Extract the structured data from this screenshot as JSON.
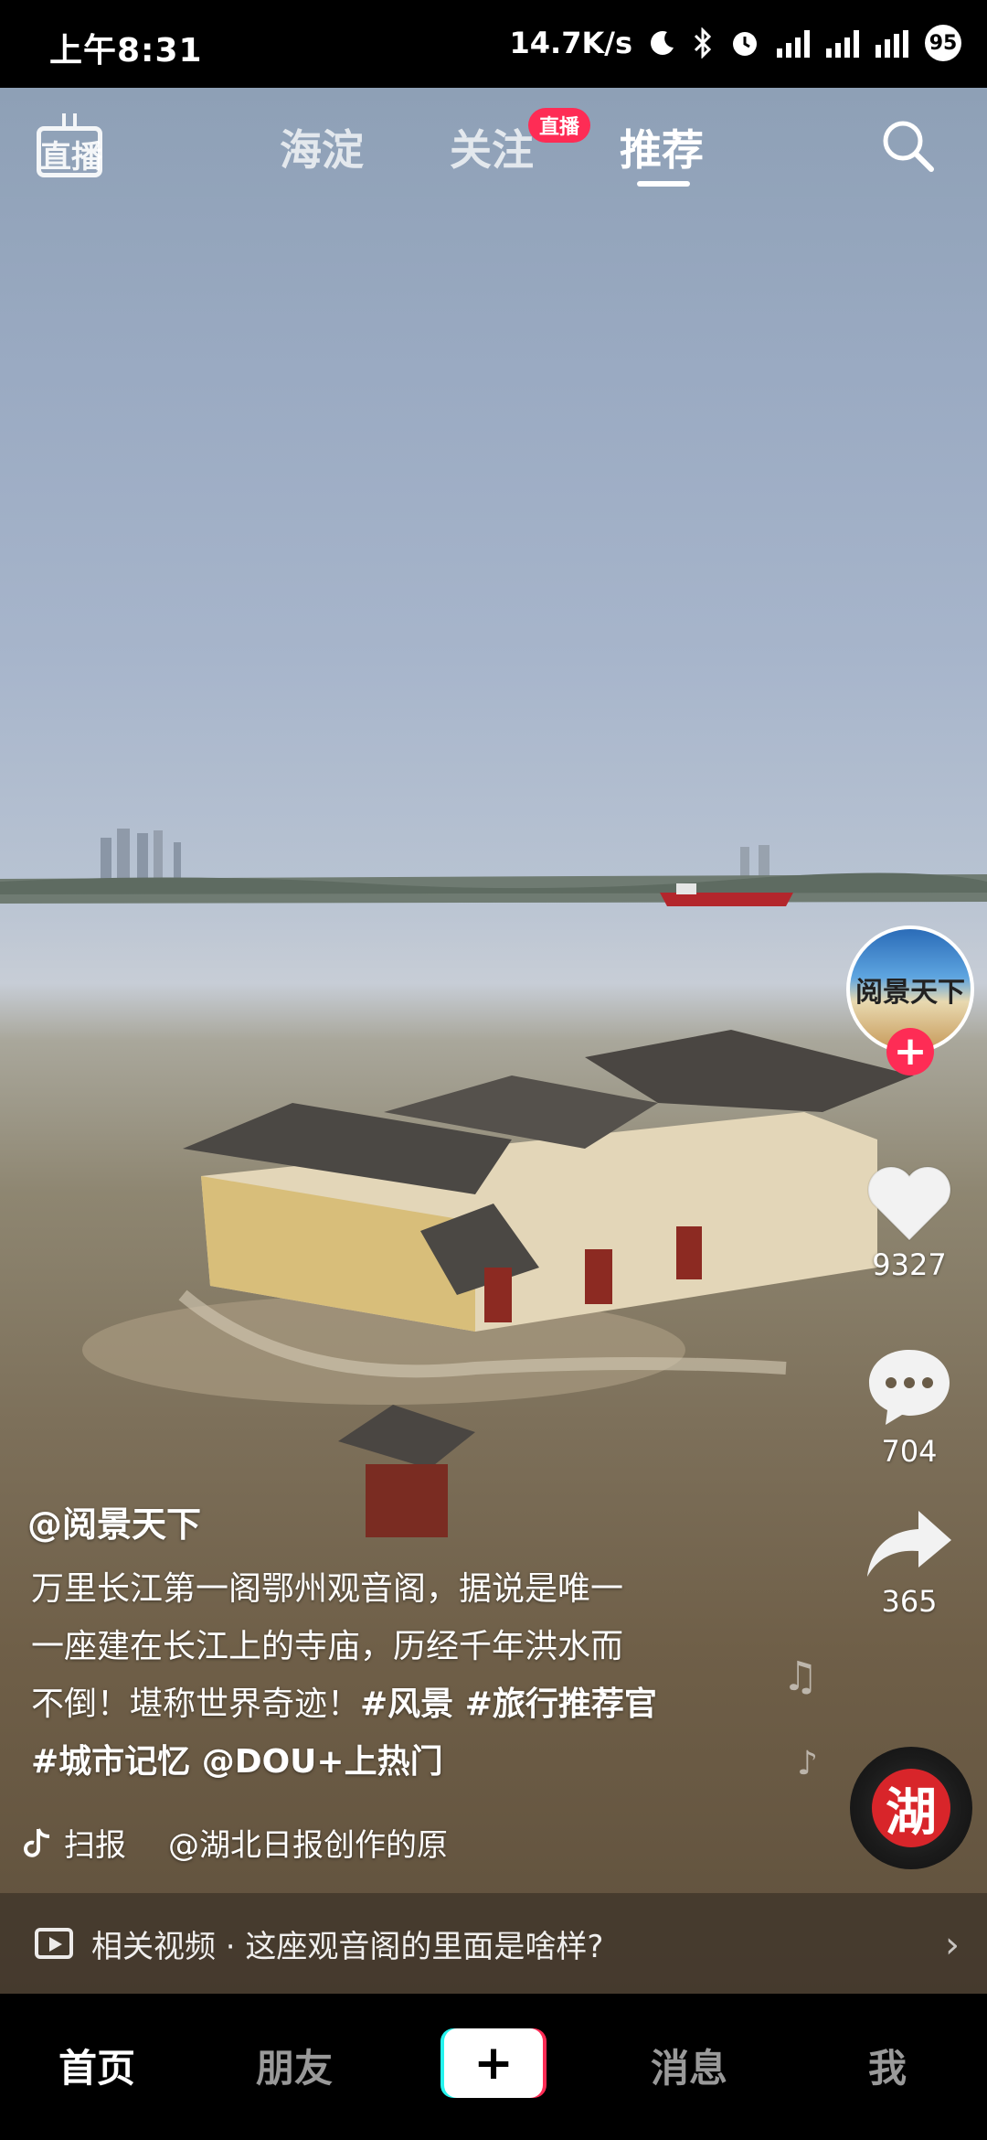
{
  "status_bar": {
    "time": "上午8:31",
    "network_speed": "14.7K/s",
    "battery": "95",
    "icons": [
      "moon-icon",
      "bluetooth-icon",
      "alarm-icon",
      "signal-hd-icon",
      "signal-hd-icon",
      "wifi-icon"
    ]
  },
  "top_nav": {
    "live_label": "直播",
    "tabs": [
      {
        "label": "海淀",
        "active": false
      },
      {
        "label": "关注",
        "active": false,
        "badge": "直播"
      },
      {
        "label": "推荐",
        "active": true
      }
    ],
    "search_icon": "search-icon"
  },
  "video": {
    "author_avatar_text": "阅景天下",
    "likes": "9327",
    "comments": "704",
    "shares": "365",
    "disc_text": "湖"
  },
  "caption": {
    "author": "@阅景天下",
    "line1": "万里长江第一阁鄂州观音阁，据说是唯一",
    "line2": "一座建在长江上的寺庙，历经千年洪水而",
    "line3_text": "不倒！堪称世界奇迹！",
    "line3_tags": "#风景 #旅行推荐官",
    "line4_tags": "#城市记忆 @DOU+上热门",
    "source_label": "扫报",
    "source_by": "@湖北日报创作的原"
  },
  "related": {
    "text": "相关视频 · 这座观音阁的里面是啥样?"
  },
  "bottom_nav": {
    "items": [
      {
        "label": "首页",
        "active": true
      },
      {
        "label": "朋友",
        "active": false
      },
      {
        "label": "消息",
        "active": false
      },
      {
        "label": "我",
        "active": false
      }
    ],
    "create_symbol": "+"
  }
}
